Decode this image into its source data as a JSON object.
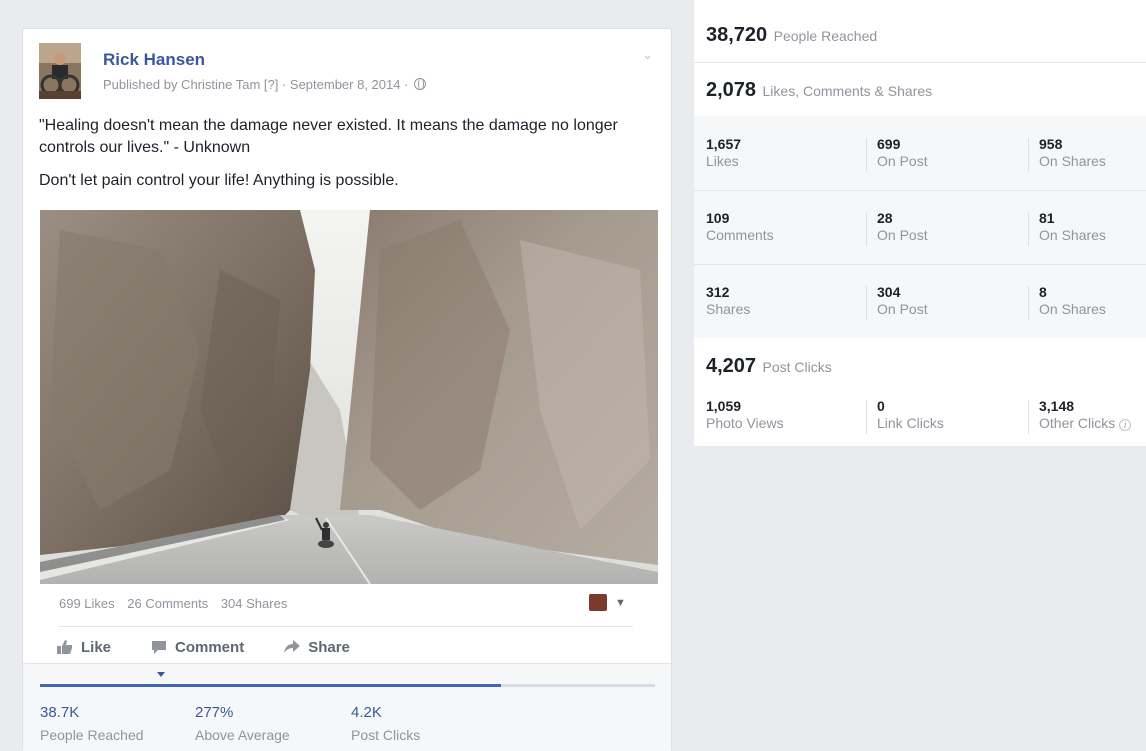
{
  "post": {
    "author": "Rick Hansen",
    "published_by": "Published by Christine Tam [?] · September 8, 2014 ·",
    "text_line1": "\"Healing doesn't mean the damage never existed. It means the damage no longer controls our lives.\" - Unknown",
    "text_line2": "Don't let pain control your life! Anything is possible.",
    "counts": {
      "likes": "699 Likes",
      "comments": "26 Comments",
      "shares": "304 Shares"
    },
    "actions": {
      "like": "Like",
      "comment": "Comment",
      "share": "Share"
    },
    "insights": {
      "reached_value": "38.7K",
      "reached_label": "People Reached",
      "average_value": "277%",
      "average_label": "Above Average",
      "clicks_value": "4.2K",
      "clicks_label": "Post Clicks",
      "progress_fraction": 0.75
    }
  },
  "stats": {
    "reached": {
      "value": "38,720",
      "label": "People Reached"
    },
    "engagement": {
      "value": "2,078",
      "label": "Likes, Comments & Shares"
    },
    "rows": [
      {
        "total": "1,657",
        "total_label": "Likes",
        "on_post": "699",
        "on_post_label": "On Post",
        "on_shares": "958",
        "on_shares_label": "On Shares"
      },
      {
        "total": "109",
        "total_label": "Comments",
        "on_post": "28",
        "on_post_label": "On Post",
        "on_shares": "81",
        "on_shares_label": "On Shares"
      },
      {
        "total": "312",
        "total_label": "Shares",
        "on_post": "304",
        "on_post_label": "On Post",
        "on_shares": "8",
        "on_shares_label": "On Shares"
      }
    ],
    "post_clicks": {
      "value": "4,207",
      "label": "Post Clicks"
    },
    "clicks_breakdown": {
      "photo_views": "1,059",
      "photo_views_label": "Photo Views",
      "link_clicks": "0",
      "link_clicks_label": "Link Clicks",
      "other_clicks": "3,148",
      "other_clicks_label": "Other Clicks",
      "info_glyph": "i"
    }
  },
  "colors": {
    "link_blue": "#3b5998",
    "progress_blue": "#4267b2",
    "muted_text": "#90949c"
  }
}
